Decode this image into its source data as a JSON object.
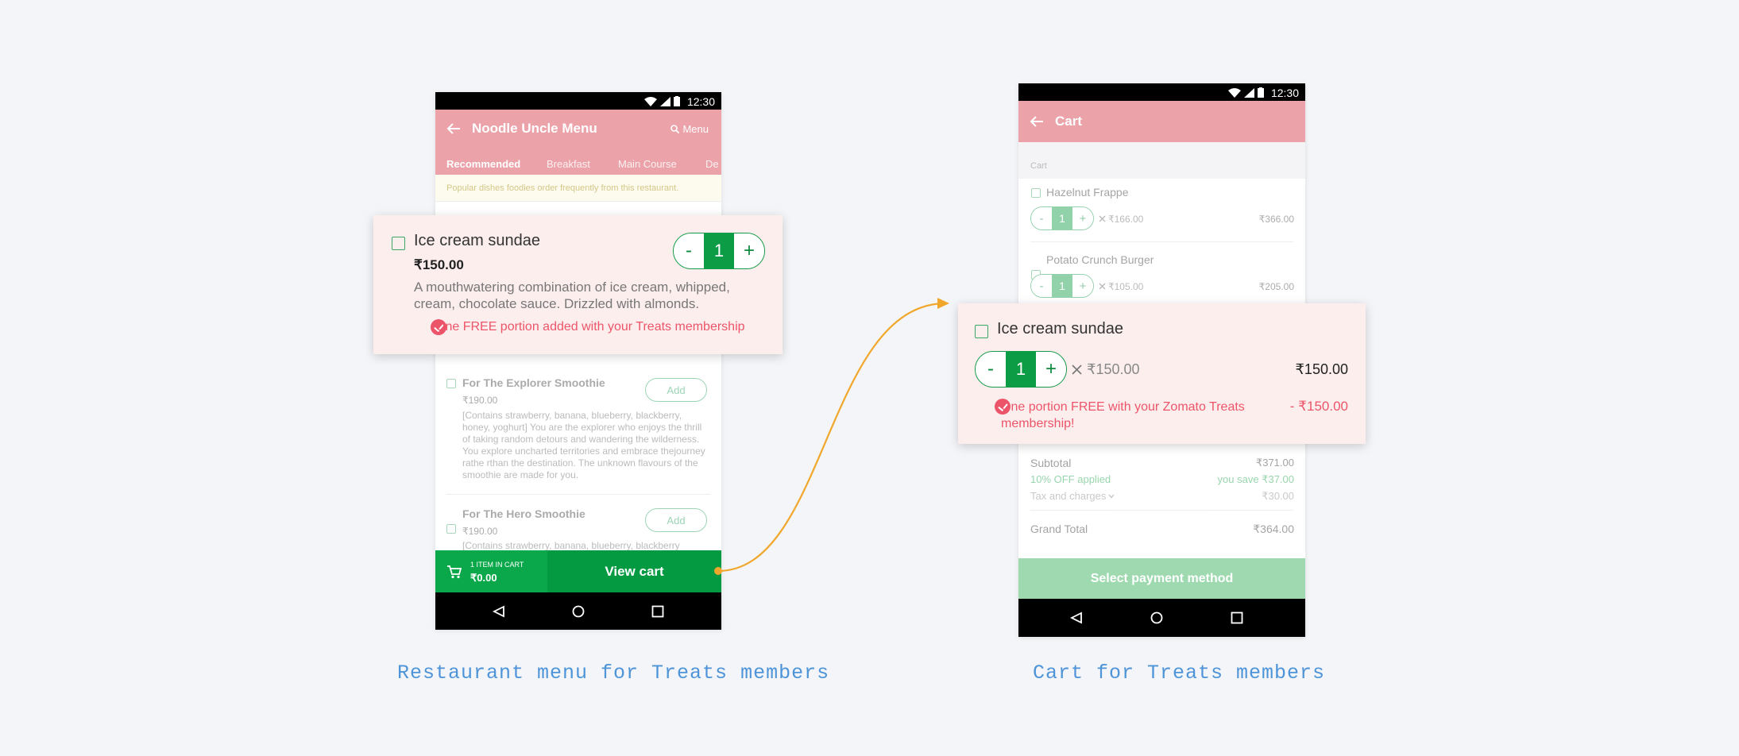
{
  "status_bar": {
    "time": "12:30"
  },
  "menu_screen": {
    "title": "Noodle Uncle Menu",
    "search_label": "Menu",
    "tabs": [
      "Recommended",
      "Breakfast",
      "Main Course",
      "De"
    ],
    "banner": "Popular dishes foodies order frequently from this restaurant.",
    "items": [
      {
        "name": "For The Explorer Smoothie",
        "price": "₹190.00",
        "description": "[Contains strawberry, banana, blueberry, blackberry, honey, yoghurt] You are the explorer who enjoys the thrill of taking random detours and wandering the wilderness. You explore uncharted territories and embrace thejourney rathe rthan the destination. The unknown flavours of the smoothie are made for you.",
        "add_label": "Add"
      },
      {
        "name": "For The Hero Smoothie",
        "price": "₹190.00",
        "description": "[Contains strawberry, banana, blueberry, blackberry",
        "add_label": "Add"
      }
    ],
    "cart_bar": {
      "items_label": "1 ITEM IN CART",
      "total": "₹0.00",
      "view_cart": "View cart"
    }
  },
  "menu_popup": {
    "name": "Ice cream sundae",
    "price": "₹150.00",
    "description": "A mouthwatering combination of ice cream, whipped, cream, chocolate sauce.  Drizzled with almonds.",
    "minus": "-",
    "qty": "1",
    "plus": "+",
    "note": "One FREE portion added with your Treats membership"
  },
  "cart_screen": {
    "title": "Cart",
    "section_label": "Cart",
    "items": [
      {
        "name": "Hazelnut Frappe",
        "minus": "-",
        "qty": "1",
        "plus": "+",
        "unit_price": "₹166.00",
        "total": "₹366.00"
      },
      {
        "name": "Potato Crunch Burger",
        "minus": "-",
        "qty": "1",
        "plus": "+",
        "unit_price": "₹105.00",
        "total": "₹205.00"
      }
    ],
    "summary": {
      "subtotal_label": "Subtotal",
      "subtotal": "₹371.00",
      "discount_label": "10% OFF applied",
      "discount": "you save ₹37.00",
      "tax_label": "Tax and charges",
      "tax": "₹30.00",
      "grand_label": "Grand Total",
      "grand": "₹364.00"
    },
    "pay_button": "Select payment method"
  },
  "cart_popup": {
    "name": "Ice cream sundae",
    "minus": "-",
    "qty": "1",
    "plus": "+",
    "unit_price": "₹150.00",
    "total": "₹150.00",
    "note": "One portion FREE with your Zomato Treats membership!",
    "discount": "- ₹150.00"
  },
  "captions": {
    "left": "Restaurant menu for Treats members",
    "right": "Cart for Treats members"
  },
  "colors": {
    "appbar": "#eba2a9",
    "green": "#0c9c46",
    "pink_text": "#ec5569",
    "popup_bg": "#fdeeee",
    "caption": "#4d94d8",
    "arrow": "#f1a72c"
  },
  "icons": [
    "wifi-icon",
    "signal-icon",
    "battery-icon",
    "back-arrow-icon",
    "search-icon",
    "cart-icon",
    "check-circle-icon",
    "veg-icon",
    "nav-back-icon",
    "nav-home-icon",
    "nav-recents-icon",
    "times-icon",
    "chevron-down-icon"
  ]
}
